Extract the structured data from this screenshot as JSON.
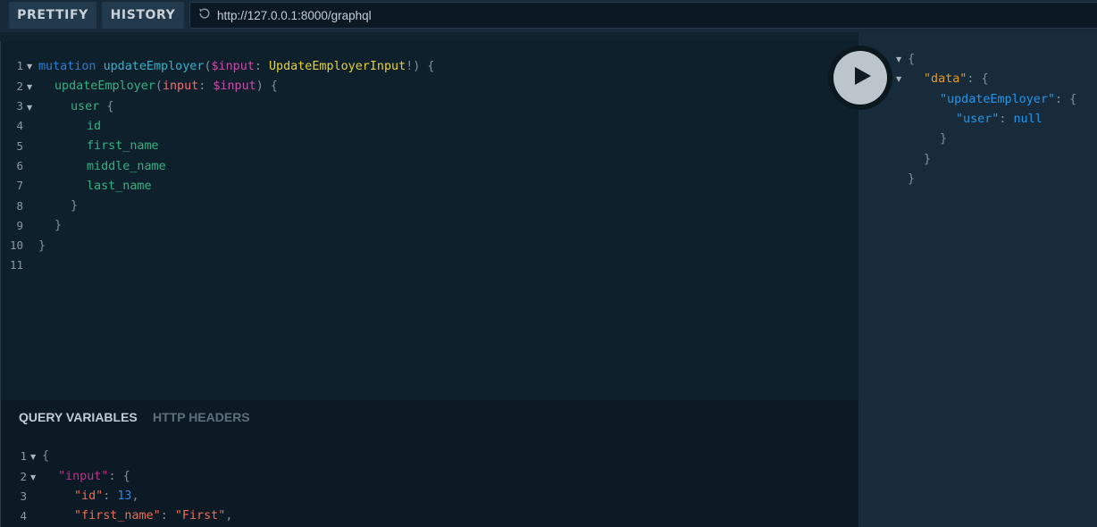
{
  "toolbar": {
    "prettify_label": "PRETTIFY",
    "history_label": "HISTORY",
    "endpoint_url": "http://127.0.0.1:8000/graphql"
  },
  "query_editor": {
    "line_numbers": [
      "1",
      "2",
      "3",
      "4",
      "5",
      "6",
      "7",
      "8",
      "9",
      "10",
      "11"
    ],
    "l1": {
      "kw": "mutation",
      "name": "updateEmployer",
      "open": "(",
      "var": "$input",
      "colon": ":",
      "type": "UpdateEmployerInput",
      "close": "!) {"
    },
    "l2": {
      "field": "updateEmployer",
      "open": "(",
      "arg": "input",
      "colon": ":",
      "var": "$input",
      "close": ") {"
    },
    "l3": {
      "field": "user",
      "brace": "{"
    },
    "l4": {
      "field": "id"
    },
    "l5": {
      "field": "first_name"
    },
    "l6": {
      "field": "middle_name"
    },
    "l7": {
      "field": "last_name"
    },
    "l8": {
      "brace": "}"
    },
    "l9": {
      "brace": "}"
    },
    "l10": {
      "brace": "}"
    }
  },
  "variables_panel": {
    "tab_query_variables": "QUERY VARIABLES",
    "tab_http_headers": "HTTP HEADERS",
    "line_numbers": [
      "1",
      "2",
      "3",
      "4"
    ],
    "l1": {
      "brace": "{"
    },
    "l2": {
      "key": "\"input\"",
      "colon": ":",
      "brace": "{"
    },
    "l3": {
      "key": "\"id\"",
      "colon": ":",
      "value": "13",
      "comma": ","
    },
    "l4": {
      "key": "\"first_name\"",
      "colon": ":",
      "value": "\"First\"",
      "comma": ","
    }
  },
  "result_panel": {
    "l1": {
      "brace": "{"
    },
    "l2": {
      "key": "\"data\"",
      "colon": ":",
      "brace": "{"
    },
    "l3": {
      "key": "\"updateEmployer\"",
      "colon": ":",
      "brace": "{"
    },
    "l4": {
      "key": "\"user\"",
      "colon": ":",
      "value": "null"
    },
    "l5": {
      "brace": "}"
    },
    "l6": {
      "brace": "}"
    },
    "l7": {
      "brace": "}"
    }
  },
  "icons": {
    "refresh": "refresh-icon",
    "play": "play-icon",
    "fold": "fold-arrow-icon"
  },
  "colors": {
    "background": "#0f202d",
    "result_background": "#172b3a",
    "keyword": "#2a7ed3",
    "field": "#37b07f",
    "variable": "#c44da6",
    "type": "#e6d23a"
  }
}
